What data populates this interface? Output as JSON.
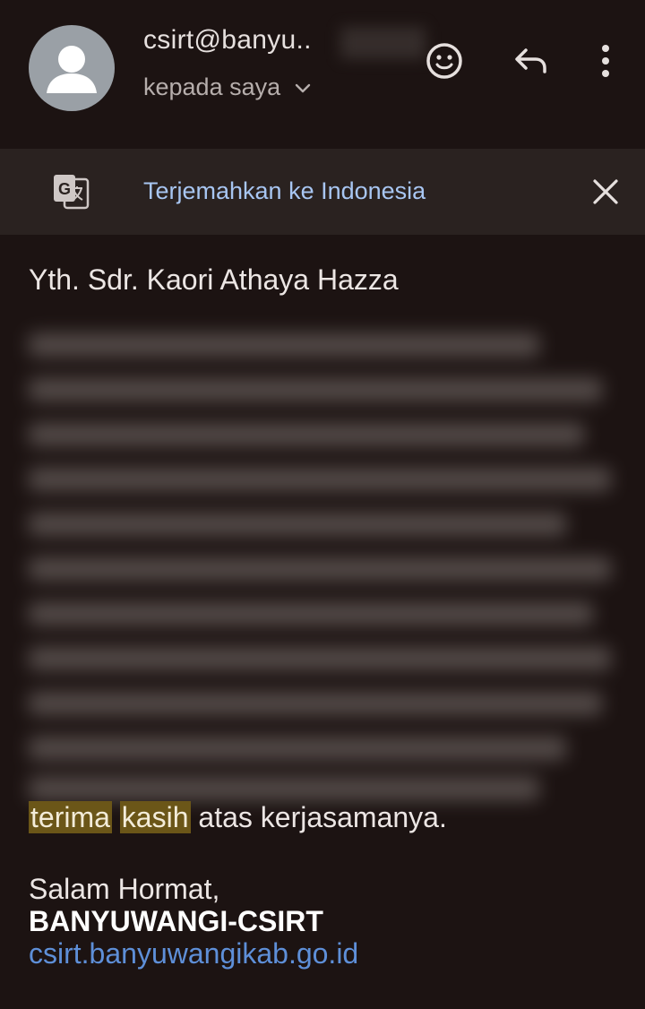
{
  "header": {
    "sender": "csirt@banyu..",
    "recipient_label": "kepada saya",
    "icons": {
      "avatar": "person-icon",
      "emoji": "smiley-icon",
      "reply": "reply-arrow-icon",
      "more": "more-vertical-icon",
      "expand": "chevron-down-icon"
    }
  },
  "translate_bar": {
    "link_text": "Terjemahkan ke Indonesia",
    "icon": "google-translate-icon",
    "close_icon": "close-icon"
  },
  "message": {
    "greeting": "Yth. Sdr. Kaori Athaya Hazza",
    "thanks_highlight_1": "terima",
    "thanks_highlight_2": "kasih",
    "thanks_rest": "atas kerjasamanya.",
    "closing": "Salam Hormat,",
    "organization": "BANYUWANGI-CSIRT",
    "website": "csirt.banyuwangikab.go.id"
  },
  "colors": {
    "background": "#1c1312",
    "translate_bar": "#2a2220",
    "link": "#a8c6f2",
    "highlight": "#6b5618",
    "website_link": "#5e8fd8"
  }
}
